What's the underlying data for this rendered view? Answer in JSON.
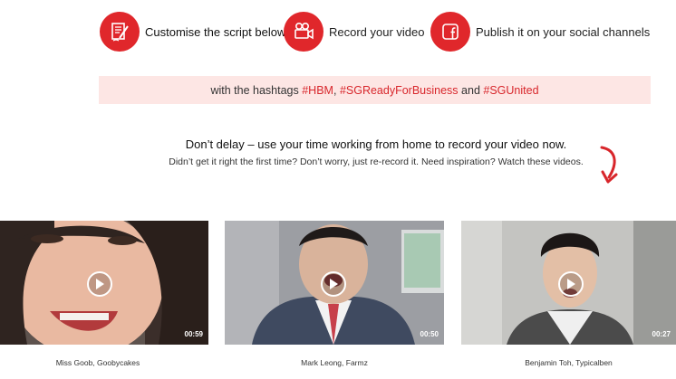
{
  "steps": [
    {
      "label": "Customise the script below",
      "icon": "script-edit-icon"
    },
    {
      "label": "Record your video",
      "icon": "video-camera-icon"
    },
    {
      "label": "Publish it on your social channels",
      "icon": "facebook-icon"
    }
  ],
  "banner": {
    "prefix": "with the hashtags",
    "tag1": "#HBM",
    "comma": ",",
    "tag2": "#SGReadyForBusiness",
    "and": "and",
    "tag3": "#SGUnited"
  },
  "intro": {
    "headline": "Don’t delay – use your time working from home to record your video now.",
    "subline": "Didn’t get it right the first time? Don’t worry, just re-record it. Need inspiration? Watch these videos."
  },
  "videos": [
    {
      "duration": "00:59",
      "caption": "Miss Goob, Goobycakes"
    },
    {
      "duration": "00:50",
      "caption": "Mark Leong, Farmz"
    },
    {
      "duration": "00:27",
      "caption": "Benjamin Toh, Typicalben"
    }
  ],
  "colors": {
    "accent": "#e0272b",
    "banner_bg": "#fde6e4"
  }
}
